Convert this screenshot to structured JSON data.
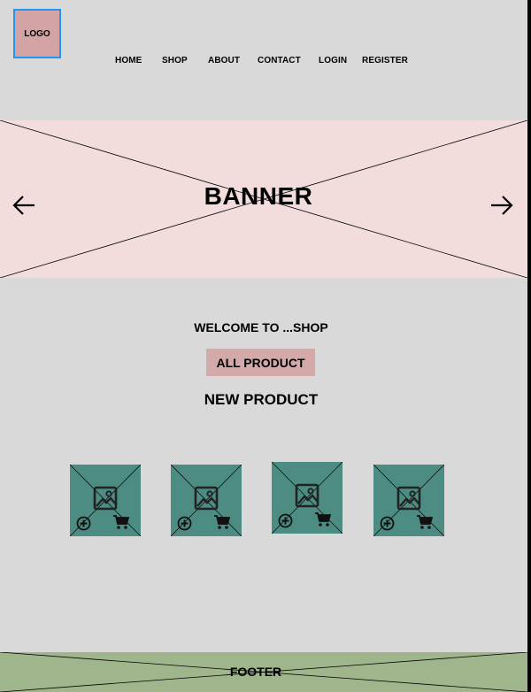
{
  "logo": {
    "label": "LOGO"
  },
  "nav": {
    "items": [
      {
        "label": "HOME"
      },
      {
        "label": "SHOP"
      },
      {
        "label": "ABOUT"
      },
      {
        "label": "CONTACT"
      },
      {
        "label": "LOGIN"
      },
      {
        "label": "REGISTER"
      }
    ]
  },
  "banner": {
    "title": "BANNER",
    "prev_icon": "arrow-left-icon",
    "next_icon": "arrow-right-icon"
  },
  "welcome": {
    "text": "WELCOME TO ...SHOP"
  },
  "all_products": {
    "label": "ALL PRODUCT"
  },
  "new_products": {
    "heading": "NEW PRODUCT",
    "cards": [
      {
        "image_icon": "image-placeholder-icon",
        "actions": [
          "add-circle-icon",
          "cart-icon"
        ]
      },
      {
        "image_icon": "image-placeholder-icon",
        "actions": [
          "add-circle-icon",
          "cart-icon"
        ]
      },
      {
        "image_icon": "image-placeholder-icon",
        "actions": [
          "add-circle-icon",
          "cart-icon"
        ]
      },
      {
        "image_icon": "image-placeholder-icon",
        "actions": [
          "add-circle-icon",
          "cart-icon"
        ]
      }
    ]
  },
  "footer": {
    "label": "FOOTER"
  },
  "colors": {
    "page_bg": "#d9d9d9",
    "logo_bg": "#d4a3a3",
    "logo_border": "#2196f3",
    "banner_bg": "#f2dcdc",
    "button_bg": "#d4a9a9",
    "card_bg": "#4d8c82",
    "footer_bg": "#9fb58c"
  }
}
